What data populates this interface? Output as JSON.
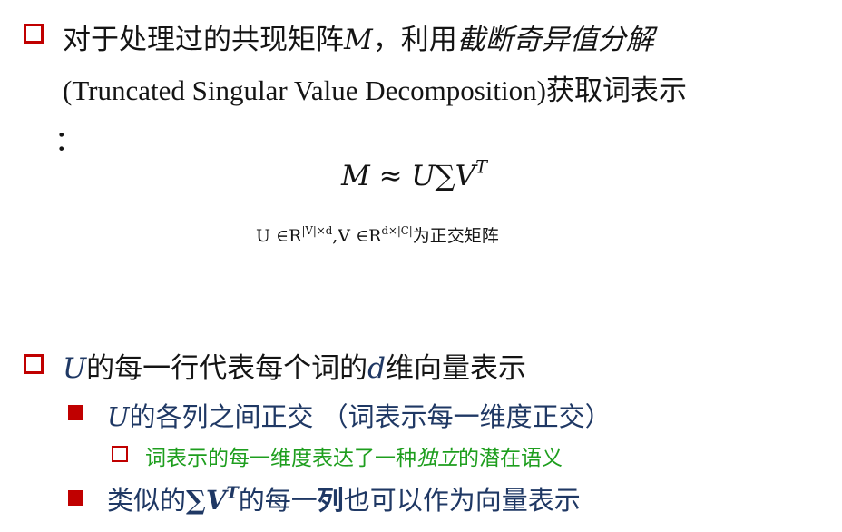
{
  "bullet1": {
    "prefix": "对于处理过的共现矩阵",
    "matrix_var": "M",
    "middle": "，利用",
    "method_cn": "截断奇异值分解",
    "line2": "(Truncated Singular Value Decomposition)获取词表示",
    "line3": "："
  },
  "formula": {
    "main": "M ≈ U∑V",
    "main_sup": "T",
    "cond_u": "U ∈R",
    "cond_u_sup": "|V|×d",
    "cond_v": ",V ∈R",
    "cond_v_sup": "d×|C|",
    "cond_suffix": "为正交矩阵"
  },
  "bullet2": {
    "var": "U",
    "text_a": "的每一行代表每个词的",
    "var_d": "d",
    "text_b": "维向量表示"
  },
  "sub1": {
    "var": "U",
    "text": "的各列之间正交 （词表示每一维度正交）"
  },
  "subsub1": {
    "text_a": "词表示的每一维度表达了一种",
    "emph": "独立",
    "text_b": "的潜在语义"
  },
  "sub2": {
    "text_a": "类似的",
    "math": "∑V",
    "math_sup": "T",
    "text_b": "的每一",
    "emph": "列",
    "text_c": "也可以作为向量表示"
  },
  "colors": {
    "bullet": "#c00000",
    "body_text": "#141414",
    "sub_text": "#1f3864",
    "subsub_text": "#1e9e1e"
  }
}
